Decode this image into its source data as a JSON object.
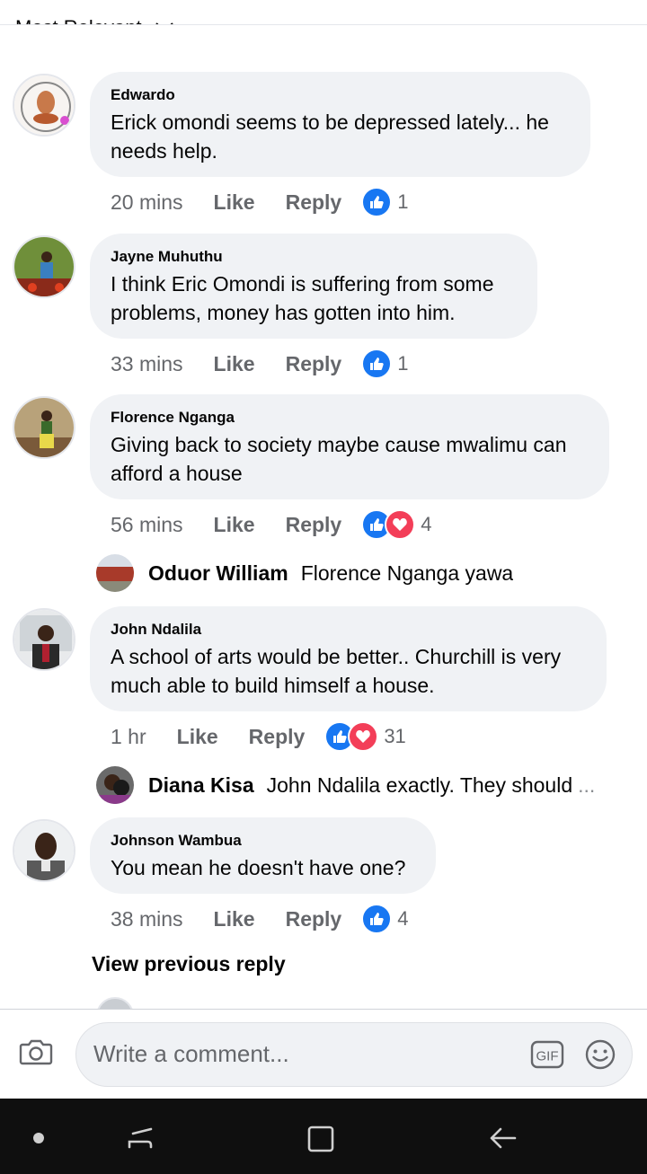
{
  "sort": {
    "label": "Most Relevant"
  },
  "comments": [
    {
      "name": "Edwardo",
      "text_lines": [
        "Erick omondi seems to be depressed lately... he",
        "needs help."
      ],
      "time": "20 mins",
      "like": "Like",
      "reply": "Reply",
      "reactions": [
        "like"
      ],
      "count": "1"
    },
    {
      "name": "Jayne Muhuthu",
      "text_lines": [
        "I think Eric Omondi is suffering from some",
        "problems, money has gotten into him."
      ],
      "time": "33 mins",
      "like": "Like",
      "reply": "Reply",
      "reactions": [
        "like"
      ],
      "count": "1"
    },
    {
      "name": "Florence Nganga",
      "text_lines": [
        "Giving back to society maybe cause mwalimu can",
        "afford a house"
      ],
      "time": "56 mins",
      "like": "Like",
      "reply": "Reply",
      "reactions": [
        "like",
        "love"
      ],
      "count": "4"
    },
    {
      "name": "John Ndalila",
      "text_lines": [
        "A school of arts would be better.. Churchill is very",
        "much able to build himself a house."
      ],
      "time": "1 hr",
      "like": "Like",
      "reply": "Reply",
      "reactions": [
        "like",
        "love"
      ],
      "count": "31"
    },
    {
      "name": "Johnson Wambua",
      "text_lines": [
        "You mean he doesn't have one?"
      ],
      "time": "38 mins",
      "like": "Like",
      "reply": "Reply",
      "reactions": [
        "like"
      ],
      "count": "4"
    }
  ],
  "replies": [
    {
      "name": "Oduor William",
      "text": "Florence Nganga yawa",
      "truncated": ""
    },
    {
      "name": "Diana Kisa",
      "text": "John Ndalila exactly.  They should",
      "truncated": "..."
    }
  ],
  "view_previous": "View previous reply",
  "composer": {
    "placeholder": "Write a comment...",
    "gif_label": "GIF"
  },
  "colors": {
    "accent": "#1877f2",
    "love": "#f33e58",
    "bubble": "#f0f2f5",
    "secondary_text": "#65676b"
  },
  "icons": [
    "chevron-down-icon",
    "camera-icon",
    "gif-icon",
    "smiley-icon",
    "like-reaction-icon",
    "love-reaction-icon",
    "nav-recents-icon",
    "nav-home-icon",
    "nav-back-icon"
  ]
}
